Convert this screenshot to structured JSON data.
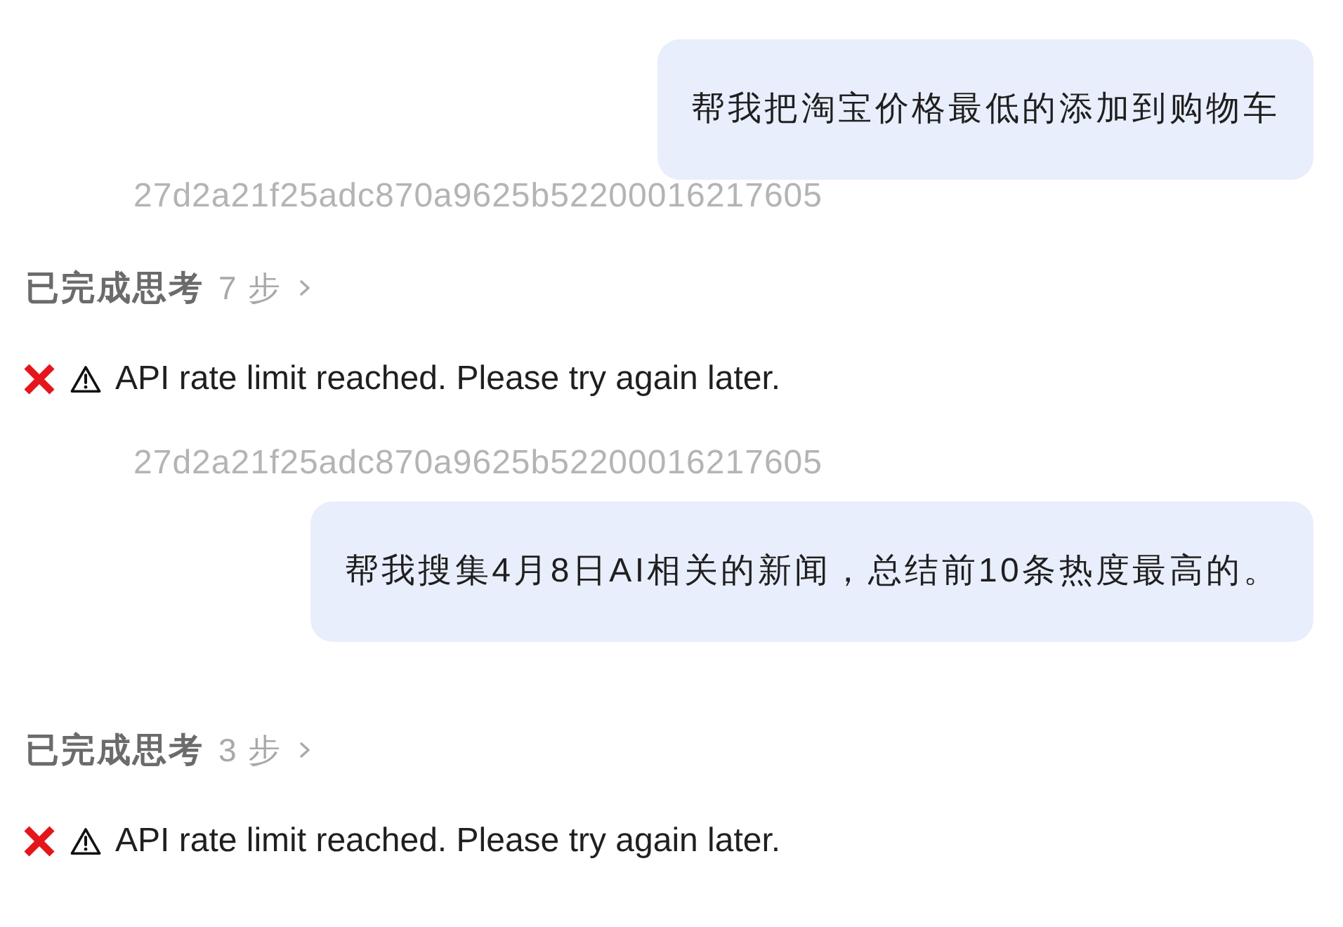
{
  "messages": [
    {
      "kind": "user",
      "text": "帮我把淘宝价格最低的添加到购物车"
    },
    {
      "kind": "trace_id",
      "text": "27d2a21f25adc870a9625b52200016217605"
    },
    {
      "kind": "thinking",
      "label": "已完成思考",
      "steps": "7 步",
      "expanded": false
    },
    {
      "kind": "error",
      "text": "API rate limit reached. Please try again later."
    },
    {
      "kind": "trace_id",
      "text": "27d2a21f25adc870a9625b52200016217605"
    },
    {
      "kind": "user",
      "text": "帮我搜集4月8日AI相关的新闻，总结前10条热度最高的。"
    },
    {
      "kind": "thinking",
      "label": "已完成思考",
      "steps": "3 步",
      "expanded": false
    },
    {
      "kind": "error",
      "text": "API rate limit reached. Please try again later."
    }
  ]
}
